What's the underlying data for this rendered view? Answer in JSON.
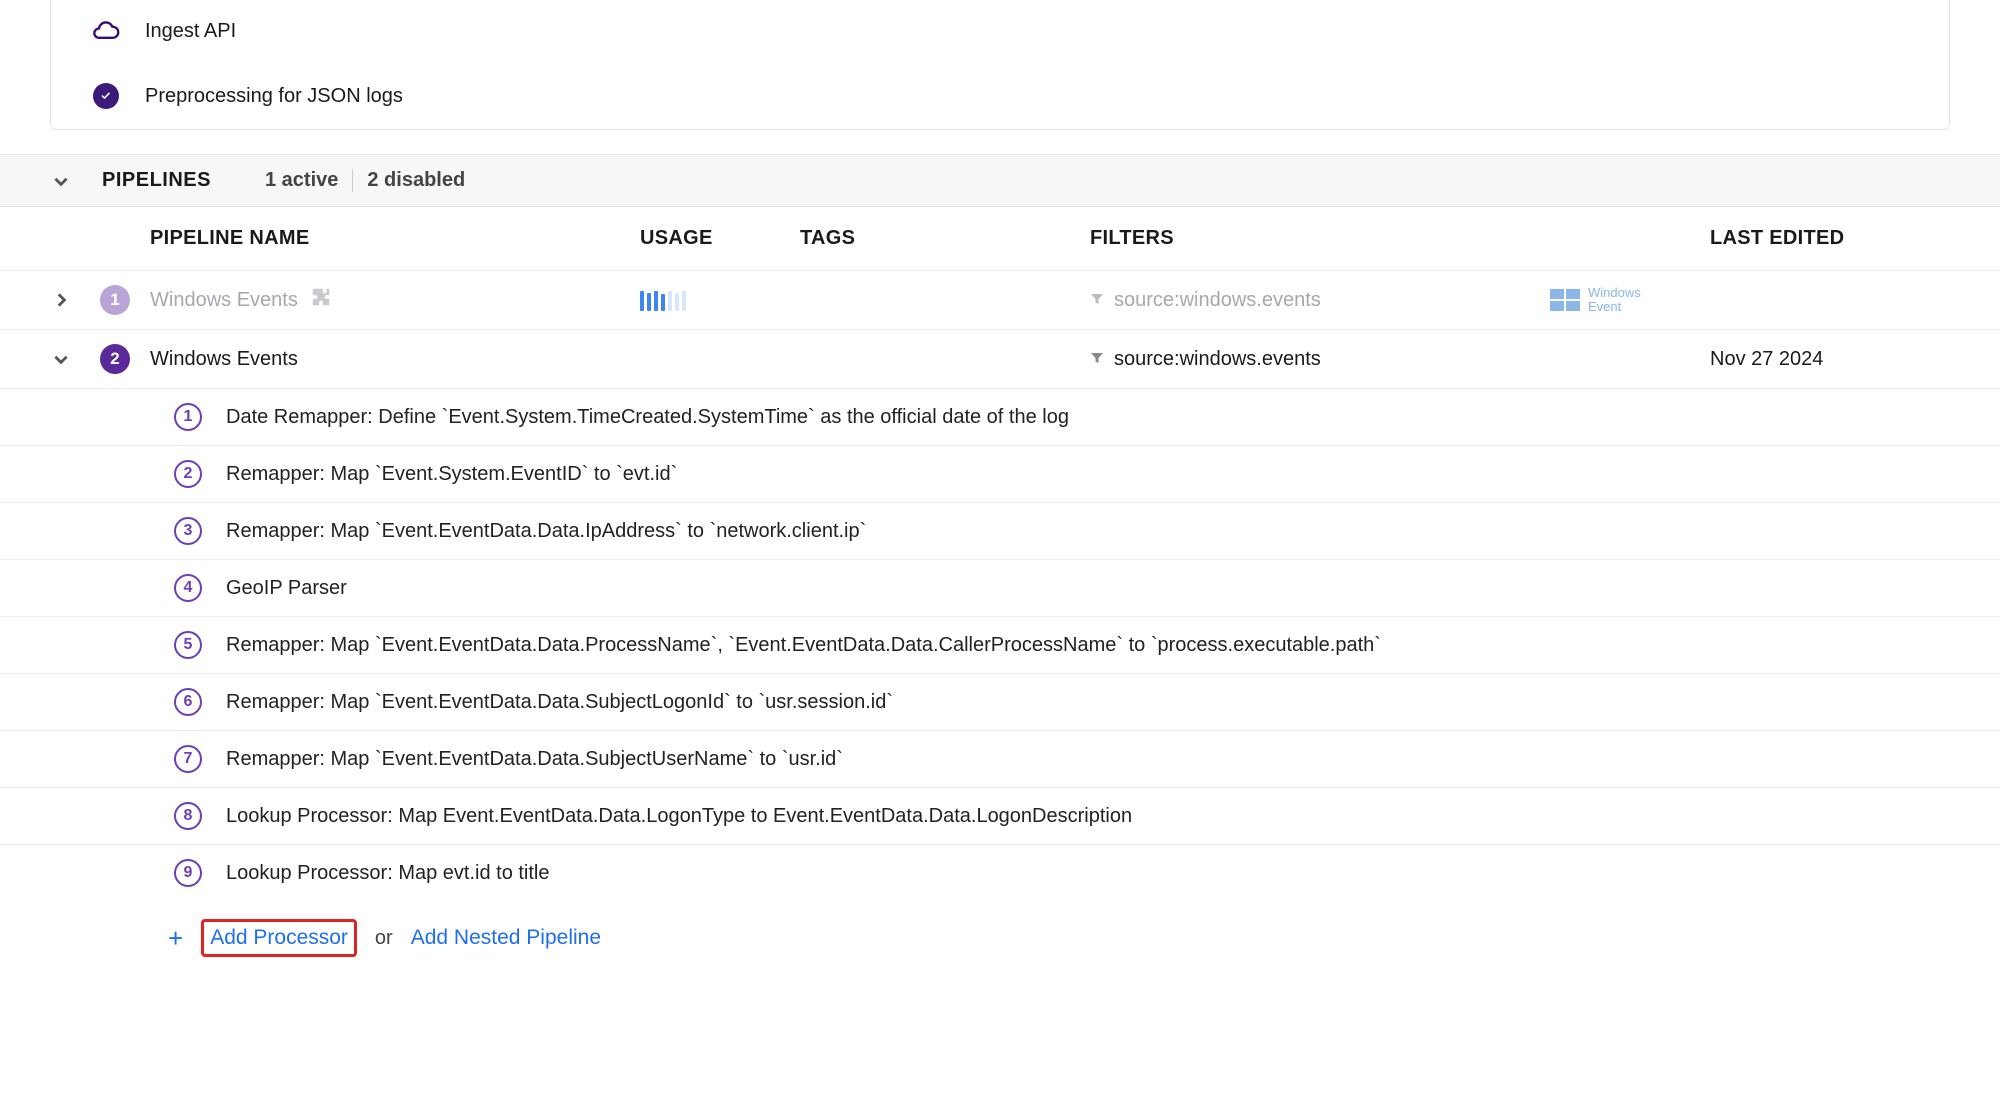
{
  "top": {
    "ingest": "Ingest API",
    "preproc": "Preprocessing for JSON logs"
  },
  "pipelinesHeader": {
    "label": "PIPELINES",
    "active": "1 active",
    "disabled": "2 disabled"
  },
  "columns": {
    "name": "PIPELINE NAME",
    "usage": "USAGE",
    "tags": "TAGS",
    "filters": "FILTERS",
    "lastEdited": "LAST EDITED"
  },
  "pipelines": [
    {
      "num": "1",
      "name": "Windows Events",
      "filter": "source:windows.events",
      "winLabel1": "Windows",
      "winLabel2": "Event"
    },
    {
      "num": "2",
      "name": "Windows Events",
      "filter": "source:windows.events",
      "lastEdited": "Nov 27 2024"
    }
  ],
  "processors": [
    {
      "n": "1",
      "text": "Date Remapper: Define `Event.System.TimeCreated.SystemTime` as the official date of the log"
    },
    {
      "n": "2",
      "text": "Remapper: Map `Event.System.EventID` to `evt.id`"
    },
    {
      "n": "3",
      "text": "Remapper: Map `Event.EventData.Data.IpAddress` to `network.client.ip`"
    },
    {
      "n": "4",
      "text": "GeoIP Parser"
    },
    {
      "n": "5",
      "text": "Remapper: Map `Event.EventData.Data.ProcessName`, `Event.EventData.Data.CallerProcessName` to `process.executable.path`"
    },
    {
      "n": "6",
      "text": "Remapper: Map `Event.EventData.Data.SubjectLogonId` to `usr.session.id`"
    },
    {
      "n": "7",
      "text": "Remapper: Map `Event.EventData.Data.SubjectUserName` to `usr.id`"
    },
    {
      "n": "8",
      "text": "Lookup Processor: Map Event.EventData.Data.LogonType to Event.EventData.Data.LogonDescription"
    },
    {
      "n": "9",
      "text": "Lookup Processor: Map evt.id to title"
    }
  ],
  "addRow": {
    "addProcessor": "Add Processor",
    "or": "or",
    "addNested": "Add Nested Pipeline"
  }
}
